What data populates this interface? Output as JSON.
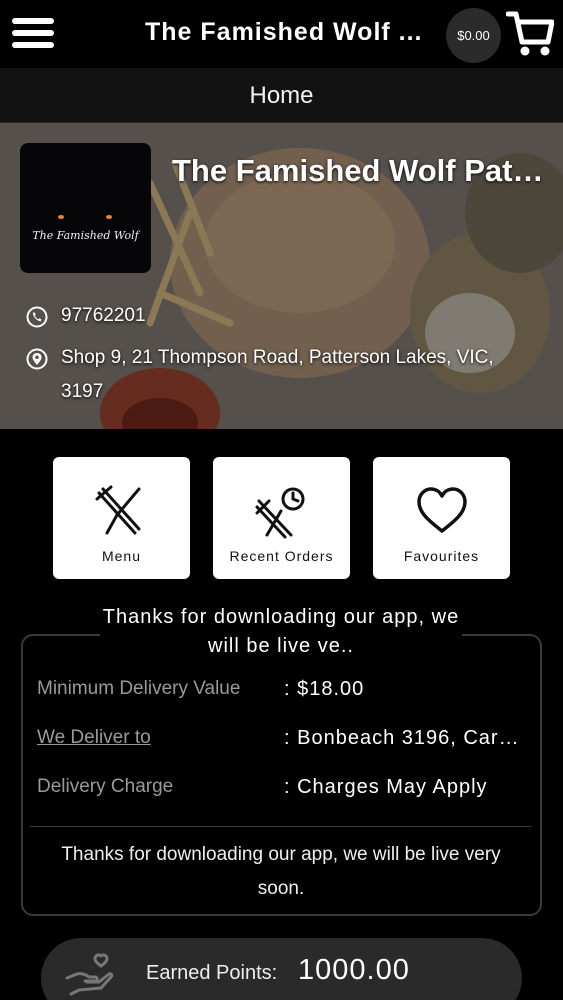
{
  "header": {
    "title": "The Famished Wolf ...",
    "cart_total": "$0.00"
  },
  "subheader": {
    "title": "Home"
  },
  "store": {
    "name": "The Famished Wolf Patte...",
    "logo_text": "The Famished Wolf",
    "phone": "97762201",
    "address": "Shop 9, 21 Thompson Road, Patterson Lakes, VIC, 3197"
  },
  "tiles": [
    {
      "label": "Menu",
      "icon": "fork-knife-icon"
    },
    {
      "label": "Recent Orders",
      "icon": "recent-orders-icon"
    },
    {
      "label": "Favourites",
      "icon": "heart-icon"
    }
  ],
  "delivery": {
    "caption": "Thanks for downloading our app, we will be live ve..",
    "rows": [
      {
        "key": "Minimum Delivery Value",
        "value": ": $18.00"
      },
      {
        "key": "We Deliver to",
        "value": ": Bonbeach 3196, Carr..."
      },
      {
        "key": "Delivery Charge",
        "value": ": Charges May Apply"
      }
    ],
    "note": "Thanks for downloading our app, we will be live very soon."
  },
  "points": {
    "label": "Earned Points:",
    "value": "1000.00"
  },
  "colors": {
    "background": "#000000",
    "tile": "#ffffff",
    "card_border": "#3a3a3a",
    "points_bg": "#2a2a2a"
  }
}
